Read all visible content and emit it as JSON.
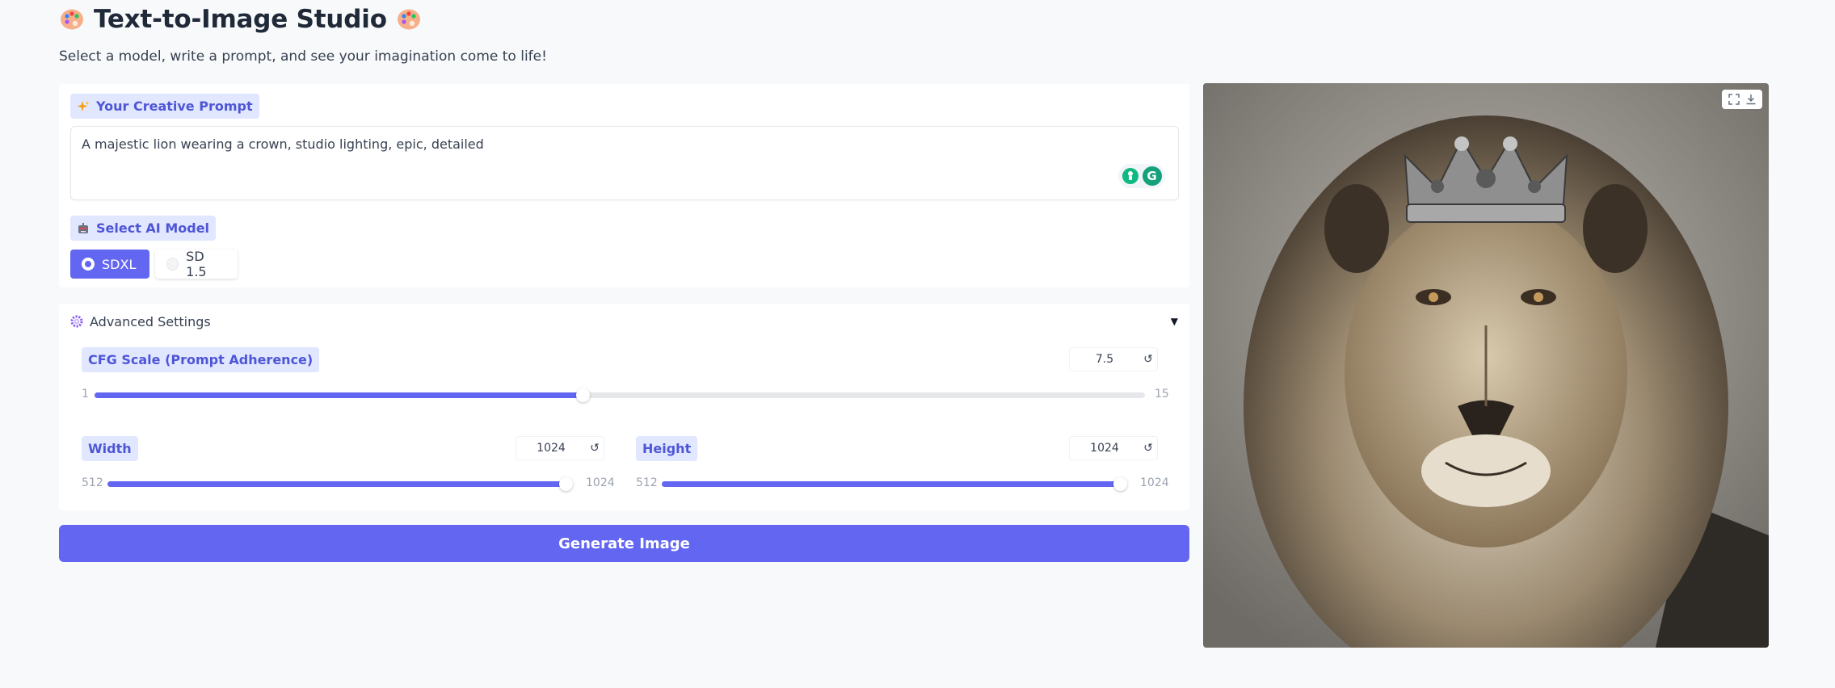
{
  "header": {
    "title": "Text-to-Image Studio",
    "subtitle": "Select a model, write a prompt, and see your imagination come to life!"
  },
  "prompt": {
    "label": "Your Creative Prompt",
    "value": "A majestic lion wearing a crown, studio lighting, epic, detailed"
  },
  "model": {
    "label": "Select AI Model",
    "options": [
      "SDXL",
      "SD 1.5"
    ],
    "selected": "SDXL"
  },
  "advanced": {
    "label": "Advanced Settings",
    "cfg": {
      "label": "CFG Scale (Prompt Adherence)",
      "value": "7.5",
      "min": "1",
      "max": "15",
      "fraction": 0.4643
    },
    "width": {
      "label": "Width",
      "value": "1024",
      "min": "512",
      "max": "1024",
      "fraction": 1.0
    },
    "height": {
      "label": "Height",
      "value": "1024",
      "min": "512",
      "max": "1024",
      "fraction": 1.0
    }
  },
  "generate_label": "Generate Image",
  "colors": {
    "accent": "#6366f1",
    "chip_bg": "#e0e7ff",
    "chip_text": "#4f56d6",
    "background": "#f8f9fb"
  },
  "icons": {
    "title": "palette-icon",
    "prompt": "sparkles-icon",
    "model": "robot-icon",
    "advanced": "gear-icon",
    "reset": "reset-icon",
    "fullscreen": "fullscreen-icon",
    "download": "download-icon"
  }
}
